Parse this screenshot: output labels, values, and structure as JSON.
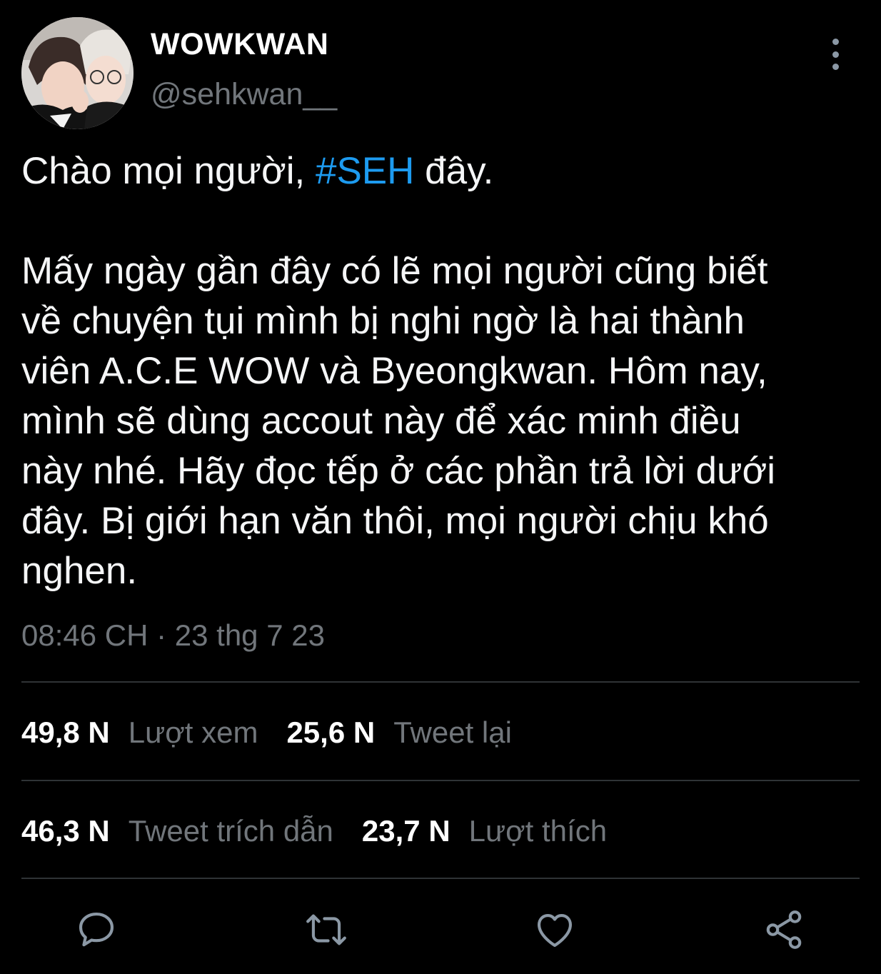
{
  "author": {
    "display_name": "WOWKWAN",
    "handle": "@sehkwan__"
  },
  "tweet": {
    "text_before": "Chào mọi người, ",
    "hashtag": "#SEH",
    "text_after": " đây.",
    "body": "Mấy ngày gần đây có lẽ mọi người cũng biết\nvề chuyện tụi mình bị nghi ngờ là hai thành\nviên A.C.E WOW và Byeongkwan. Hôm nay,\nmình sẽ dùng accout này để xác minh điều\nnày nhé. Hãy đọc tếp ở các phần trả lời dưới\nđây. Bị giới hạn văn thôi, mọi người chịu khó\nnghen.",
    "timestamp": "08:46 CH · 23 thg 7 23"
  },
  "stats": {
    "views": {
      "count": "49,8 N",
      "label": "Lượt xem"
    },
    "retweets": {
      "count": "25,6 N",
      "label": "Tweet lại"
    },
    "quotes": {
      "count": "46,3 N",
      "label": "Tweet trích dẫn"
    },
    "likes": {
      "count": "23,7 N",
      "label": "Lượt thích"
    }
  },
  "actions": {
    "icons": [
      "reply-icon",
      "retweet-icon",
      "like-icon",
      "share-icon"
    ],
    "icon_color": "#8b98a5"
  },
  "colors": {
    "background": "#000000",
    "accent": "#1d9bf0",
    "secondary_text": "#71767b",
    "divider": "#2f3336"
  }
}
